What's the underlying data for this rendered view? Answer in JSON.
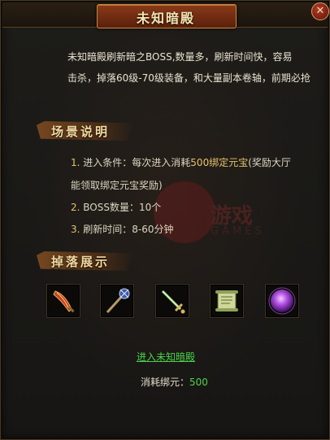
{
  "window": {
    "title": "未知暗殿",
    "close_glyph": "✕"
  },
  "description": {
    "line1": "未知暗殿刷新暗之BOSS,数量多，刷新时间快，容易",
    "line2": "击杀，掉落60级-70级装备，和大量副本卷轴，前期必抢"
  },
  "scene": {
    "header": "场景说明",
    "items": [
      {
        "index": "1.",
        "pre": "进入条件：每次进入消耗",
        "highlight": "500绑定元宝",
        "post": "(奖励大厅",
        "cont": "能领取绑定元宝奖励)"
      },
      {
        "index": "2.",
        "text": "BOSS数量：10个"
      },
      {
        "index": "3.",
        "text": "刷新时间：8-60分钟"
      }
    ]
  },
  "watermark": {
    "brand": "游戏",
    "sub": "GAMES"
  },
  "drops": {
    "header": "掉落展示",
    "items": [
      {
        "icon": "dragon-blade-icon"
      },
      {
        "icon": "mace-staff-icon"
      },
      {
        "icon": "sword-icon"
      },
      {
        "icon": "scroll-icon"
      },
      {
        "icon": "purple-orb-icon"
      }
    ]
  },
  "actions": {
    "enter_label": "进入未知暗殿",
    "cost_label": "消耗绑元：",
    "cost_value": "500"
  },
  "colors": {
    "accent_green": "#4fd24a",
    "number_gold": "#e5c36a",
    "title_plate": "#8a3a18"
  }
}
